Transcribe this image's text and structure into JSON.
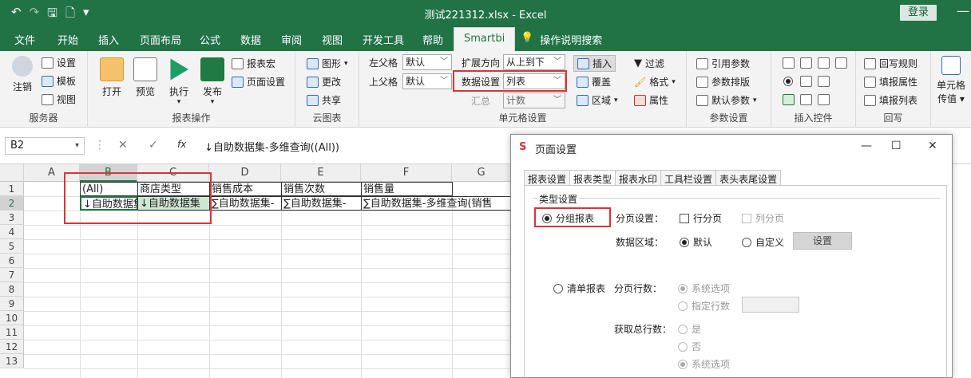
{
  "window": {
    "title": "测试221312.xlsx  -  Excel",
    "login": "登录",
    "qat": [
      "↶",
      "↷",
      "🖫",
      "🗋",
      "▾"
    ]
  },
  "tabs": [
    "文件",
    "开始",
    "插入",
    "页面布局",
    "公式",
    "数据",
    "审阅",
    "视图",
    "开发工具",
    "帮助",
    "Smartbi"
  ],
  "tell_me": "操作说明搜索",
  "ribbon": {
    "service": {
      "logout": "注销",
      "settings": "设置",
      "template": "模板",
      "view": "视图",
      "label": "服务器"
    },
    "report_ops": {
      "open": "打开",
      "preview": "预览",
      "run": "执行",
      "publish": "发布",
      "macro": "报表宏",
      "page_setup": "页面设置",
      "label": "报表操作"
    },
    "cloud": {
      "chart": "图形",
      "change": "更改",
      "share": "共享",
      "label": "云图表"
    },
    "cell_settings": {
      "left_parent": "左父格",
      "left_parent_value": "默认",
      "up_parent": "上父格",
      "up_parent_value": "默认",
      "expand_dir": "扩展方向",
      "expand_dir_value": "从上到下",
      "data_setting": "数据设置",
      "data_setting_value": "列表",
      "summary": "汇总",
      "summary_value": "计数",
      "insert": "插入",
      "cover": "覆盖",
      "region": "区域",
      "filter": "过滤",
      "format": "格式",
      "property": "属性",
      "label": "单元格设置"
    },
    "params": {
      "ref": "引用参数",
      "layout": "参数排版",
      "default": "默认参数",
      "label": "参数设置"
    },
    "controls": {
      "label": "插入控件"
    },
    "writeback": {
      "rule": "回写规则",
      "fill_prop": "填报属性",
      "fill_list": "填报列表",
      "label": "回写"
    },
    "cell_pass": {
      "line1": "单元格",
      "line2": "传值"
    }
  },
  "formula_bar": {
    "cell_ref": "B2",
    "fx": "fx",
    "formula": "↓自助数据集-多维查询((All))"
  },
  "sheet": {
    "columns": [
      "A",
      "B",
      "C",
      "D",
      "E",
      "F",
      "G"
    ],
    "rows": [
      "1",
      "2",
      "3",
      "4",
      "5",
      "6",
      "7",
      "8",
      "9",
      "10",
      "11",
      "12",
      "13"
    ],
    "row1": [
      "(All)",
      "商店类型",
      "销售成本",
      "销售次数",
      "销售量"
    ],
    "row2": [
      "↓自助数据集",
      "↓自助数据集",
      "∑自助数据集-",
      "∑自助数据集-",
      "∑自助数据集-多维查询(销售"
    ]
  },
  "dialog": {
    "title": "页面设置",
    "tabs": [
      "报表设置",
      "报表类型",
      "报表水印",
      "工具栏设置",
      "表头表尾设置"
    ],
    "active_tab": "报表类型",
    "section": "类型设置",
    "group_report": "分组报表",
    "paging": "分页设置：",
    "row_paging": "行分页",
    "col_paging": "列分页",
    "data_region": "数据区域：",
    "default": "默认",
    "custom": "自定义",
    "setup_btn": "设置",
    "list_report": "清单报表",
    "page_rows": "分页行数：",
    "sys_option": "系统选项",
    "specify_rows": "指定行数",
    "total_rows": "获取总行数：",
    "yes": "是",
    "no": "否",
    "sys_option2": "系统选项"
  },
  "colors": {
    "excel_green": "#217346",
    "highlight_red": "#d9343a"
  }
}
